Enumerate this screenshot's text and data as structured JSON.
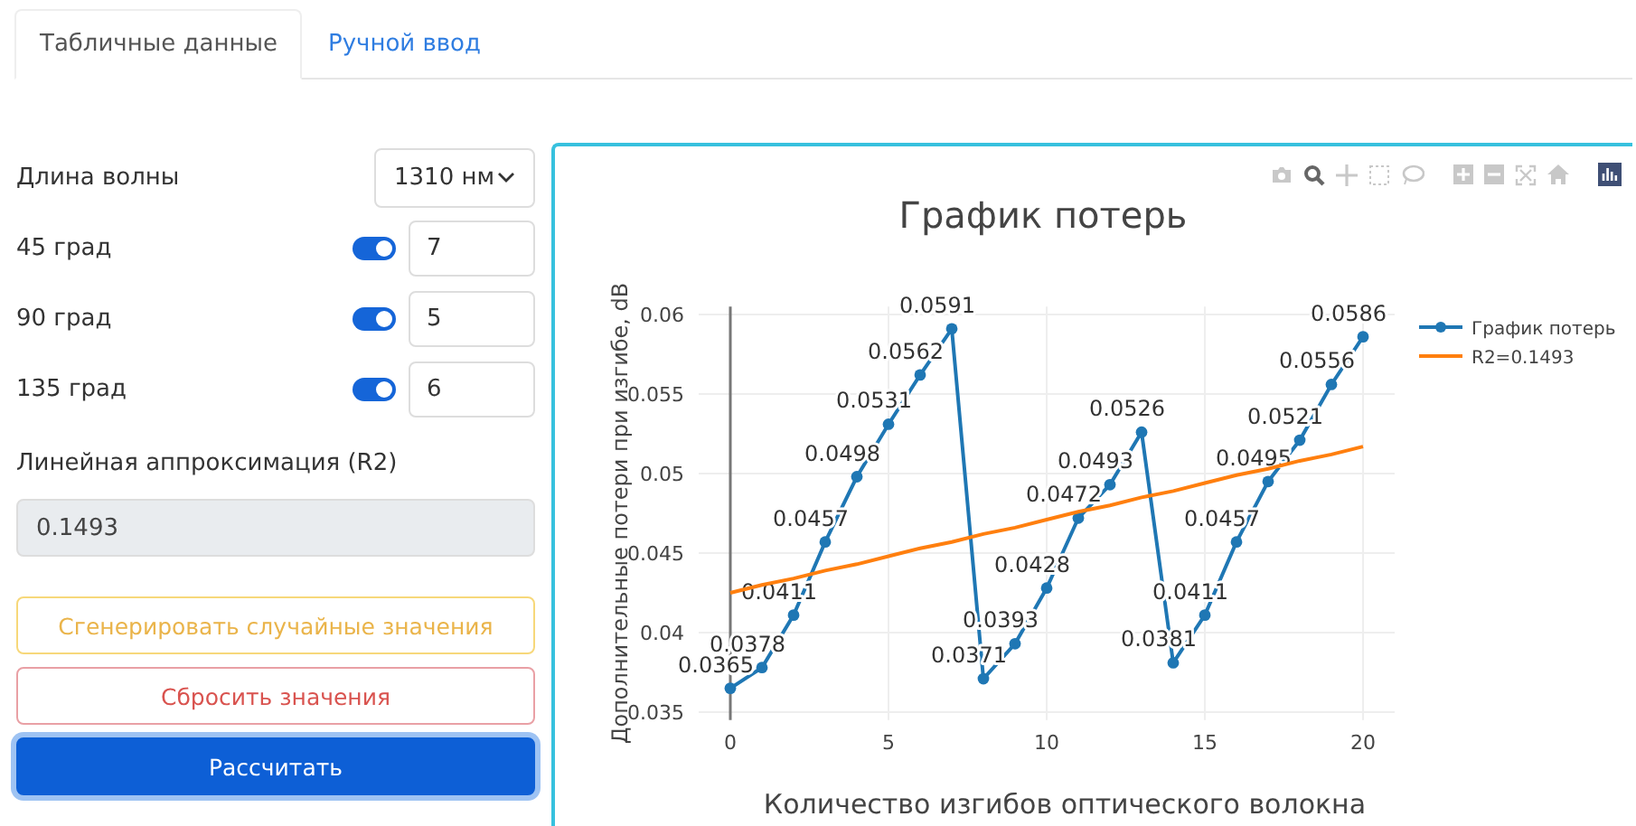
{
  "tabs": [
    {
      "label": "Табличные данные",
      "selected": true
    },
    {
      "label": "Ручной ввод",
      "selected": false
    }
  ],
  "form": {
    "wavelength": {
      "label": "Длина волны",
      "value": "1310 нм"
    },
    "angles": [
      {
        "label": "45 град",
        "on": true,
        "value": "7"
      },
      {
        "label": "90 град",
        "on": true,
        "value": "5"
      },
      {
        "label": "135 град",
        "on": true,
        "value": "6"
      }
    ],
    "r2": {
      "label": "Линейная аппроксимация (R2)",
      "value": "0.1493"
    },
    "buttons": [
      {
        "label": "Сгенерировать случайные значения",
        "kind": "warning"
      },
      {
        "label": "Сбросить значения",
        "kind": "danger"
      },
      {
        "label": "Рассчитать",
        "kind": "primary"
      }
    ]
  },
  "chart": {
    "chart_data": {
      "type": "line",
      "title": "График потерь",
      "xlabel": "Количество изгибов оптического волокна",
      "ylabel": "Дополнительные потери при изгибе, dB",
      "x": [
        0,
        1,
        2,
        3,
        4,
        5,
        6,
        7,
        8,
        9,
        10,
        11,
        12,
        13,
        14,
        15,
        16,
        17,
        18,
        19,
        20
      ],
      "series": [
        {
          "name": "График потерь",
          "color": "#1f77b4",
          "marker": "circle",
          "value_labels": [
            "0.0365",
            "0.0378",
            "0.0411",
            "0.0457",
            "0.0498",
            "0.0531",
            "0.0562",
            "0.0591",
            "0.0371",
            "0.0393",
            "0.0428",
            "0.0472",
            "0.0493",
            "0.0526",
            "0.0381",
            "0.0411",
            "0.0457",
            "0.0495",
            "0.0521",
            "0.0556",
            "0.0586"
          ],
          "values": [
            0.0365,
            0.0378,
            0.0411,
            0.0457,
            0.0498,
            0.0531,
            0.0562,
            0.0591,
            0.0371,
            0.0393,
            0.0428,
            0.0472,
            0.0493,
            0.0526,
            0.0381,
            0.0411,
            0.0457,
            0.0495,
            0.0521,
            0.0556,
            0.0586
          ]
        },
        {
          "name": "R2=0.1493",
          "color": "#ff7f0e",
          "values": [
            0.0425,
            0.043,
            0.0434,
            0.0439,
            0.0443,
            0.0448,
            0.0453,
            0.0457,
            0.0462,
            0.0466,
            0.0471,
            0.0476,
            0.048,
            0.0485,
            0.0489,
            0.0494,
            0.0499,
            0.0503,
            0.0508,
            0.0512,
            0.0517
          ]
        }
      ],
      "xlim": [
        -1,
        21
      ],
      "ylim": [
        0.0345,
        0.0605
      ],
      "xticks": [
        0,
        5,
        10,
        15,
        20
      ],
      "yticks": [
        0.035,
        0.04,
        0.045,
        0.05,
        0.055,
        0.06
      ],
      "grid": true,
      "legend": true
    }
  }
}
